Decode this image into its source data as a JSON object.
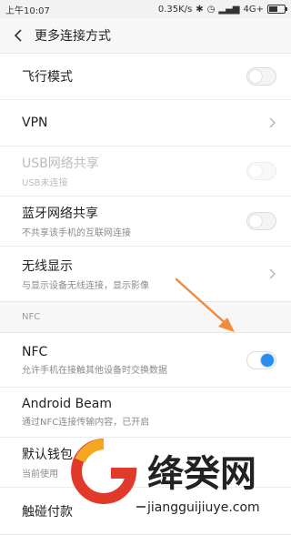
{
  "status": {
    "time": "上午10:07",
    "speed": "0.35K/s",
    "network": "4G+"
  },
  "header": {
    "title": "更多连接方式"
  },
  "group1": {
    "airplane": {
      "title": "飞行模式"
    },
    "vpn": {
      "title": "VPN"
    },
    "usb": {
      "title": "USB网络共享",
      "subtitle": "USB未连接"
    },
    "bt": {
      "title": "蓝牙网络共享",
      "subtitle": "不共享该手机的互联网连接"
    },
    "wireless": {
      "title": "无线显示",
      "subtitle": "与显示设备无线连接，显示影像"
    }
  },
  "nfc_section": {
    "label": "NFC"
  },
  "group2": {
    "nfc": {
      "title": "NFC",
      "subtitle": "允许手机在接触其他设备时交换数据"
    },
    "beam": {
      "title": "Android Beam",
      "subtitle": "通过NFC连接传输内容，已开启"
    },
    "wallet": {
      "title": "默认钱包",
      "subtitle": "当前使用"
    },
    "tap": {
      "title": "触碰付款"
    }
  },
  "watermark": {
    "brand": "绛癸网",
    "url": "jiangguijiuye.com"
  },
  "colors": {
    "accent": "#2a8ef0",
    "arrow": "#f08a3c",
    "watermark_red": "#e23a2a"
  },
  "icons": [
    "back-icon",
    "chevron-right-icon",
    "annotation-arrow",
    "watermark-logo"
  ]
}
